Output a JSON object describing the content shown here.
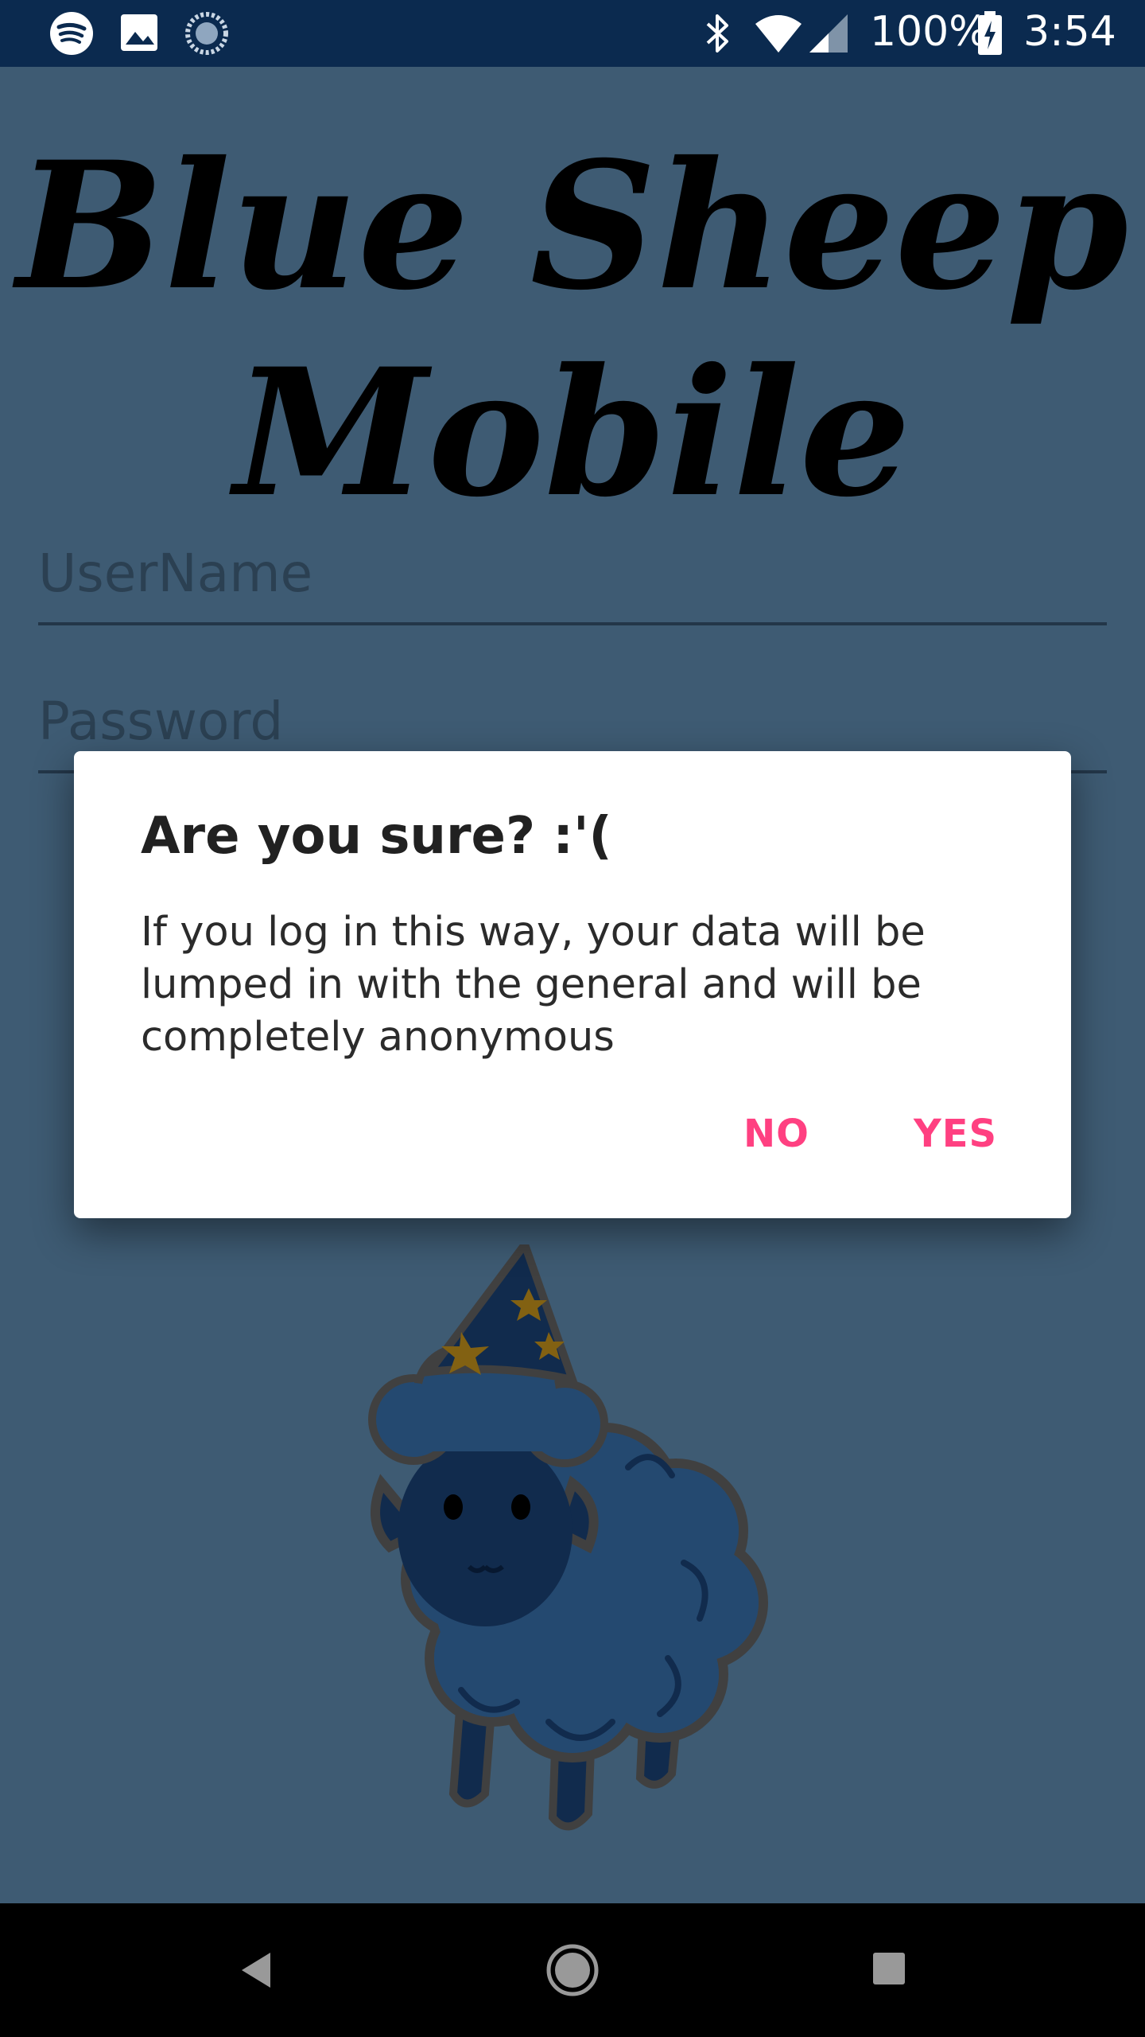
{
  "status_bar": {
    "battery": "100%",
    "time": "3:54",
    "icons": [
      "spotify-icon",
      "image-icon",
      "sync-icon",
      "bluetooth-icon",
      "wifi-icon",
      "cell-signal-icon",
      "battery-charging-icon"
    ]
  },
  "app": {
    "title_line1": "Blue Sheep",
    "title_line2": "Mobile"
  },
  "form": {
    "username_placeholder": "UserName",
    "password_placeholder": "Password"
  },
  "dialog": {
    "title": "Are you sure? :'(",
    "message": "If you log in this way, your data will be lumped in with the general and will be completely anonymous",
    "negative_label": "NO",
    "positive_label": "YES"
  },
  "nav_bar": {
    "icons": [
      "back-icon",
      "home-icon",
      "recents-icon"
    ]
  },
  "colors": {
    "status_bar": "#0b2a4f",
    "background": "#6b9dc7",
    "accent": "#ff4081",
    "scrim_alpha": "0.42"
  },
  "mascot": "wizard-sheep-illustration"
}
